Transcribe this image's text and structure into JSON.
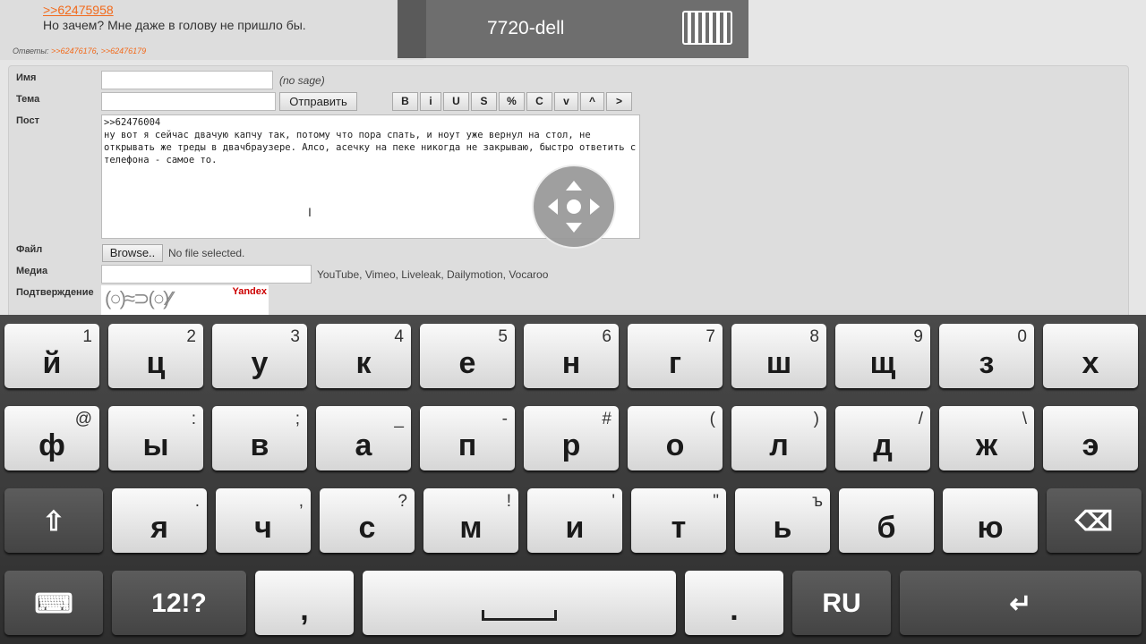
{
  "post": {
    "reply_link": ">>62475958",
    "message": "Но зачем? Мне даже в голову не пришло бы.",
    "answers_label": "Ответы:",
    "answers": [
      ">>62476176",
      ">>62476179"
    ]
  },
  "remote": {
    "device": "7720-dell"
  },
  "form": {
    "name_label": "Имя",
    "name_value": "",
    "sage_note": "(no sage)",
    "subject_label": "Тема",
    "subject_value": "",
    "submit": "Отправить",
    "markup_buttons": [
      "B",
      "i",
      "U",
      "S",
      "%",
      "C",
      "v",
      "^",
      ">"
    ],
    "post_label": "Пост",
    "post_value": ">>62476004\nну вот я сейчас двачую капчу так, потому что пора спать, и ноут уже вернул на стол, не открывать же треды в двачбраузере. Алсо, асечку на пеке никогда не закрываю, быстро ответить с телефона - самое то.",
    "file_label": "Файл",
    "browse": "Browse..",
    "file_status": "No file selected.",
    "media_label": "Медиа",
    "media_value": "",
    "media_note": "YouTube, Vimeo, Liveleak, Dailymotion, Vocaroo",
    "captcha_label": "Подтверждение",
    "captcha_brand": "Yandex"
  },
  "keyboard": {
    "row1": [
      {
        "k": "й",
        "h": "1"
      },
      {
        "k": "ц",
        "h": "2"
      },
      {
        "k": "у",
        "h": "3"
      },
      {
        "k": "к",
        "h": "4"
      },
      {
        "k": "е",
        "h": "5"
      },
      {
        "k": "н",
        "h": "6"
      },
      {
        "k": "г",
        "h": "7"
      },
      {
        "k": "ш",
        "h": "8"
      },
      {
        "k": "щ",
        "h": "9"
      },
      {
        "k": "з",
        "h": "0"
      },
      {
        "k": "х",
        "h": ""
      }
    ],
    "row2": [
      {
        "k": "ф",
        "h": "@"
      },
      {
        "k": "ы",
        "h": ":"
      },
      {
        "k": "в",
        "h": ";"
      },
      {
        "k": "а",
        "h": "_"
      },
      {
        "k": "п",
        "h": "-"
      },
      {
        "k": "р",
        "h": "#"
      },
      {
        "k": "о",
        "h": "("
      },
      {
        "k": "л",
        "h": ")"
      },
      {
        "k": "д",
        "h": "/"
      },
      {
        "k": "ж",
        "h": "\\"
      },
      {
        "k": "э",
        "h": ""
      }
    ],
    "row3": [
      {
        "k": "я",
        "h": "."
      },
      {
        "k": "ч",
        "h": ","
      },
      {
        "k": "с",
        "h": "?"
      },
      {
        "k": "м",
        "h": "!"
      },
      {
        "k": "и",
        "h": "'"
      },
      {
        "k": "т",
        "h": "\""
      },
      {
        "k": "ь",
        "h": "ъ"
      },
      {
        "k": "б",
        "h": ""
      },
      {
        "k": "ю",
        "h": ""
      }
    ],
    "symbols": "12!?",
    "comma": ",",
    "period": ".",
    "lang": "RU",
    "shift_icon": "⇧",
    "backspace_icon": "⌫",
    "enter_icon": "↵",
    "keyboard_icon": "⌨"
  }
}
